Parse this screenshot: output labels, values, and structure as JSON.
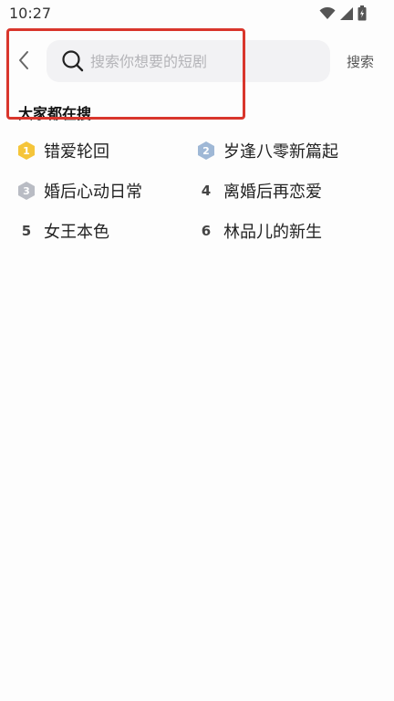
{
  "status_bar": {
    "time": "10:27",
    "icons": [
      "wifi-icon",
      "signal-icon",
      "battery-icon"
    ]
  },
  "search": {
    "placeholder": "搜索你想要的短剧",
    "submit_label": "搜索"
  },
  "hot_section": {
    "title": "大家都在搜",
    "items": [
      {
        "rank": "1",
        "title": "错爱轮回"
      },
      {
        "rank": "2",
        "title": "岁逢八零新篇起"
      },
      {
        "rank": "3",
        "title": "婚后心动日常"
      },
      {
        "rank": "4",
        "title": "离婚后再恋爱"
      },
      {
        "rank": "5",
        "title": "女王本色"
      },
      {
        "rank": "6",
        "title": "林品儿的新生"
      }
    ]
  },
  "colors": {
    "highlight_frame": "#d9362c",
    "rank1_badge": "#f5c53a",
    "rank2_badge": "#9fb8d6",
    "rank3_badge": "#b9bcc4",
    "search_bg": "#f2f2f4"
  }
}
